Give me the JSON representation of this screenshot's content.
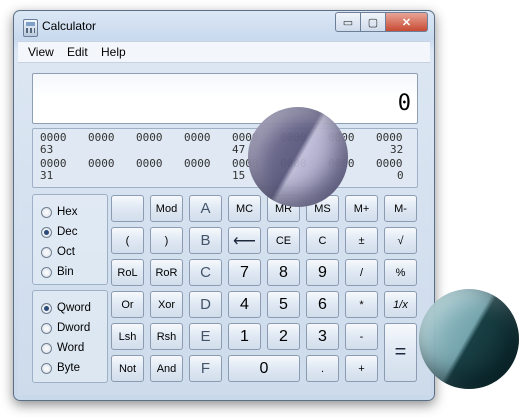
{
  "window": {
    "title": "Calculator",
    "caption": {
      "minimize": "▭",
      "maximize": "▢",
      "close": "✕"
    }
  },
  "menu": [
    "View",
    "Edit",
    "Help"
  ],
  "display": {
    "value": "0"
  },
  "bits": {
    "row1": [
      "0000",
      "0000",
      "0000",
      "0000",
      "0000",
      "0000",
      "0000",
      "0000"
    ],
    "row1_labels": [
      "63",
      "47",
      "32"
    ],
    "row2": [
      "0000",
      "0000",
      "0000",
      "0000",
      "0000",
      "0000",
      "0000",
      "0000"
    ],
    "row2_labels": [
      "31",
      "15",
      "0"
    ]
  },
  "radix": {
    "options": [
      "Hex",
      "Dec",
      "Oct",
      "Bin"
    ],
    "selected": "Dec"
  },
  "word_size": {
    "options": [
      "Qword",
      "Dword",
      "Word",
      "Byte"
    ],
    "selected": "Qword"
  },
  "keys": {
    "row1": [
      "",
      "Mod",
      "A",
      "MC",
      "MR",
      "MS",
      "M+",
      "M-"
    ],
    "row2": [
      "(",
      ")",
      "B",
      "⟵",
      "CE",
      "C",
      "±",
      "√"
    ],
    "row3": [
      "RoL",
      "RoR",
      "C",
      "7",
      "8",
      "9",
      "/",
      "%"
    ],
    "row4": [
      "Or",
      "Xor",
      "D",
      "4",
      "5",
      "6",
      "*",
      "1/x"
    ],
    "row5": [
      "Lsh",
      "Rsh",
      "E",
      "1",
      "2",
      "3",
      "-",
      "="
    ],
    "row6": [
      "Not",
      "And",
      "F",
      "0",
      ".",
      "+"
    ]
  }
}
